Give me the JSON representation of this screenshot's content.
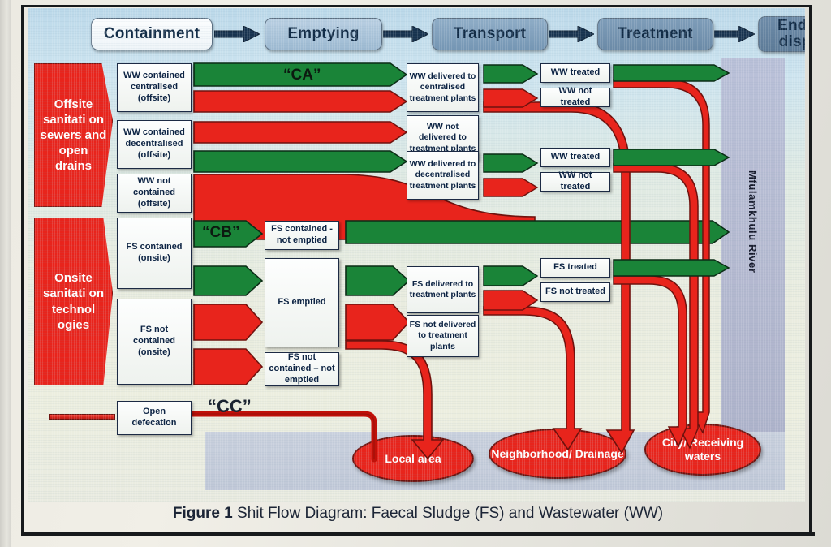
{
  "figure": {
    "caption_bold": "Figure 1",
    "caption_text": "Shit Flow Diagram: Faecal Sludge (FS) and Wastewater (WW)"
  },
  "header": {
    "stages": [
      {
        "label": "Containment"
      },
      {
        "label": "Emptying"
      },
      {
        "label": "Transport"
      },
      {
        "label": "Treatment"
      },
      {
        "label": "End-use/ disposal"
      }
    ]
  },
  "categories": [
    {
      "id": "offsite",
      "label": "Offsite sanitati on  sewers and open drains"
    },
    {
      "id": "onsite",
      "label": "Onsite sanitati on technol ogies"
    }
  ],
  "containment": [
    {
      "label": "WW contained centralised (offsite)"
    },
    {
      "label": "WW contained decentralised (offsite)"
    },
    {
      "label": "WW not contained (offsite)"
    },
    {
      "label": "FS contained (onsite)"
    },
    {
      "label": "FS not contained (onsite)"
    },
    {
      "label": "Open defecation"
    }
  ],
  "emptying": [
    {
      "label": "FS contained - not emptied"
    },
    {
      "label": "FS emptied"
    },
    {
      "label": "FS not contained – not emptied"
    }
  ],
  "transport": [
    {
      "label": "WW delivered to centralised treatment plants"
    },
    {
      "label": "WW not delivered to treatment plants"
    },
    {
      "label": "WW delivered to decentralised treatment plants"
    },
    {
      "label": "FS delivered to treatment plants"
    },
    {
      "label": "FS not delivered to treatment plants"
    }
  ],
  "treatment": [
    {
      "label": "WW treated"
    },
    {
      "label": "WW not treated"
    },
    {
      "label": "WW treated"
    },
    {
      "label": "WW not treated"
    },
    {
      "label": "FS treated"
    },
    {
      "label": "FS not treated"
    }
  ],
  "enduse": {
    "river_label": "Mfulamkhulu River",
    "destinations": [
      {
        "label": "Local area"
      },
      {
        "label": "Neighborhood/ Drainage"
      },
      {
        "label": "City/ Receiving waters"
      }
    ]
  },
  "codes": [
    {
      "id": "ca",
      "label": "“CA”"
    },
    {
      "id": "cb",
      "label": "“CB”"
    },
    {
      "id": "cc",
      "label": "“CC”"
    }
  ],
  "colors": {
    "safe_green": "#1a8438",
    "unsafe_red": "#e8241c",
    "river": "#b0b6d0",
    "header_light": "#f3f7fa",
    "header_dark": "#6d8ba8",
    "text_dark": "#0d2444"
  }
}
